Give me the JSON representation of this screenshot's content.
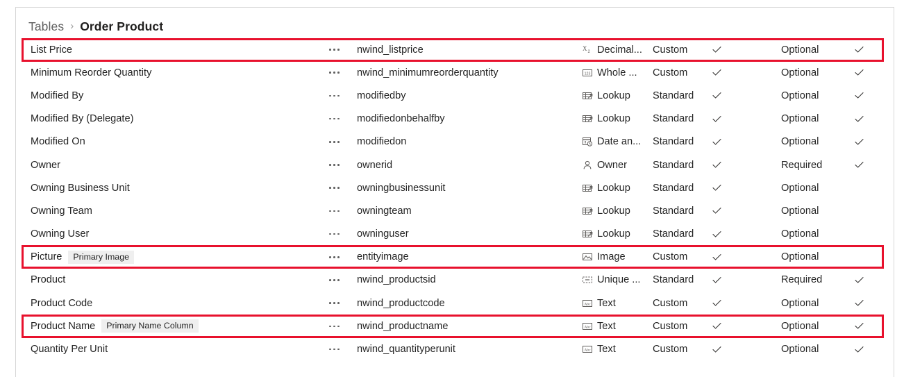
{
  "breadcrumb": {
    "parent": "Tables",
    "separator": "›",
    "current": "Order Product"
  },
  "colors": {
    "highlight": "#e8112d",
    "text": "#242424",
    "muted": "#616161",
    "badge_bg": "#efefef",
    "panel_border": "#d6d6d6",
    "icon": "#605e5c"
  },
  "icons": {
    "menu": "ellipsis-icon",
    "check": "checkmark-icon",
    "chevron": "chevron-right-icon"
  },
  "grid": {
    "rows": [
      {
        "display_name": "List Price",
        "badge": "",
        "logical_name": "nwind_listprice",
        "data_type": "Decimal...",
        "type_icon": "decimal-icon",
        "customization": "Custom",
        "customization_check": true,
        "requirement": "Optional",
        "requirement_check": true,
        "highlighted": true
      },
      {
        "display_name": "Minimum Reorder Quantity",
        "badge": "",
        "logical_name": "nwind_minimumreorderquantity",
        "data_type": "Whole ...",
        "type_icon": "whole-number-icon",
        "customization": "Custom",
        "customization_check": true,
        "requirement": "Optional",
        "requirement_check": true,
        "highlighted": false
      },
      {
        "display_name": "Modified By",
        "badge": "",
        "logical_name": "modifiedby",
        "data_type": "Lookup",
        "type_icon": "lookup-icon",
        "customization": "Standard",
        "customization_check": true,
        "requirement": "Optional",
        "requirement_check": true,
        "highlighted": false
      },
      {
        "display_name": "Modified By (Delegate)",
        "badge": "",
        "logical_name": "modifiedonbehalfby",
        "data_type": "Lookup",
        "type_icon": "lookup-icon",
        "customization": "Standard",
        "customization_check": true,
        "requirement": "Optional",
        "requirement_check": true,
        "highlighted": false
      },
      {
        "display_name": "Modified On",
        "badge": "",
        "logical_name": "modifiedon",
        "data_type": "Date an...",
        "type_icon": "date-time-icon",
        "customization": "Standard",
        "customization_check": true,
        "requirement": "Optional",
        "requirement_check": true,
        "highlighted": false
      },
      {
        "display_name": "Owner",
        "badge": "",
        "logical_name": "ownerid",
        "data_type": "Owner",
        "type_icon": "owner-person-icon",
        "customization": "Standard",
        "customization_check": true,
        "requirement": "Required",
        "requirement_check": true,
        "highlighted": false
      },
      {
        "display_name": "Owning Business Unit",
        "badge": "",
        "logical_name": "owningbusinessunit",
        "data_type": "Lookup",
        "type_icon": "lookup-icon",
        "customization": "Standard",
        "customization_check": true,
        "requirement": "Optional",
        "requirement_check": false,
        "highlighted": false
      },
      {
        "display_name": "Owning Team",
        "badge": "",
        "logical_name": "owningteam",
        "data_type": "Lookup",
        "type_icon": "lookup-icon",
        "customization": "Standard",
        "customization_check": true,
        "requirement": "Optional",
        "requirement_check": false,
        "highlighted": false
      },
      {
        "display_name": "Owning User",
        "badge": "",
        "logical_name": "owninguser",
        "data_type": "Lookup",
        "type_icon": "lookup-icon",
        "customization": "Standard",
        "customization_check": true,
        "requirement": "Optional",
        "requirement_check": false,
        "highlighted": false
      },
      {
        "display_name": "Picture",
        "badge": "Primary Image",
        "logical_name": "entityimage",
        "data_type": "Image",
        "type_icon": "image-icon",
        "customization": "Custom",
        "customization_check": true,
        "requirement": "Optional",
        "requirement_check": false,
        "highlighted": true
      },
      {
        "display_name": "Product",
        "badge": "",
        "logical_name": "nwind_productsid",
        "data_type": "Unique ...",
        "type_icon": "unique-identifier-icon",
        "customization": "Standard",
        "customization_check": true,
        "requirement": "Required",
        "requirement_check": true,
        "highlighted": false
      },
      {
        "display_name": "Product Code",
        "badge": "",
        "logical_name": "nwind_productcode",
        "data_type": "Text",
        "type_icon": "text-icon",
        "customization": "Custom",
        "customization_check": true,
        "requirement": "Optional",
        "requirement_check": true,
        "highlighted": false
      },
      {
        "display_name": "Product Name",
        "badge": "Primary Name Column",
        "logical_name": "nwind_productname",
        "data_type": "Text",
        "type_icon": "text-icon",
        "customization": "Custom",
        "customization_check": true,
        "requirement": "Optional",
        "requirement_check": true,
        "highlighted": true
      },
      {
        "display_name": "Quantity Per Unit",
        "badge": "",
        "logical_name": "nwind_quantityperunit",
        "data_type": "Text",
        "type_icon": "text-icon",
        "customization": "Custom",
        "customization_check": true,
        "requirement": "Optional",
        "requirement_check": true,
        "highlighted": false
      }
    ]
  }
}
